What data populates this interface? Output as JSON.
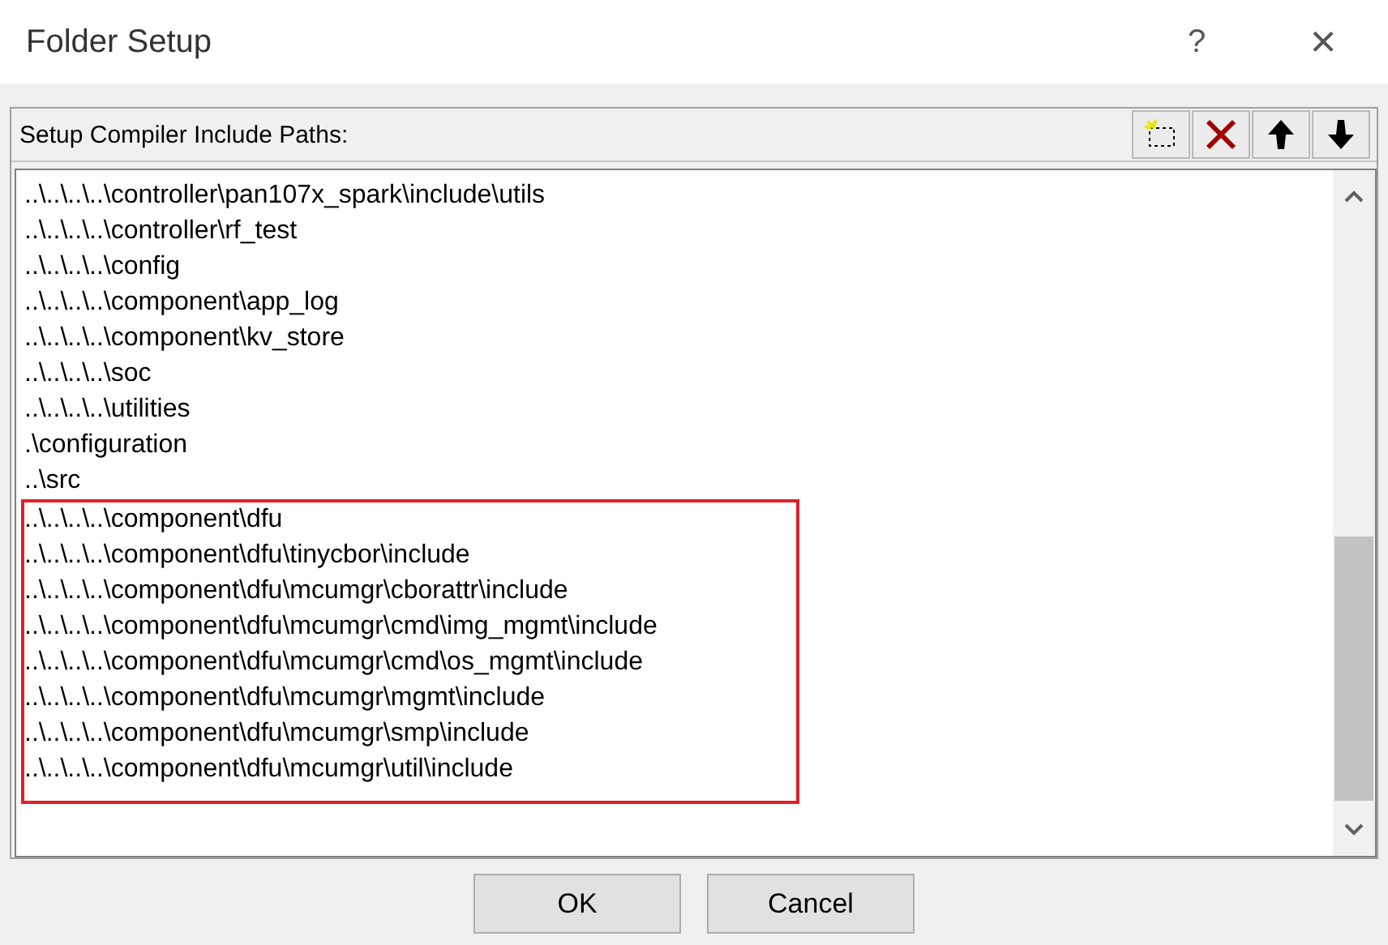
{
  "window": {
    "title": "Folder Setup",
    "help": "?",
    "close": "×"
  },
  "panel": {
    "title": "Setup Compiler Include Paths:"
  },
  "paths": [
    {
      "text": "..\\..\\..\\..\\controller\\pan107x_spark\\include\\utils",
      "highlighted": false
    },
    {
      "text": "..\\..\\..\\..\\controller\\rf_test",
      "highlighted": false
    },
    {
      "text": "..\\..\\..\\..\\config",
      "highlighted": false
    },
    {
      "text": "..\\..\\..\\..\\component\\app_log",
      "highlighted": false
    },
    {
      "text": "..\\..\\..\\..\\component\\kv_store",
      "highlighted": false
    },
    {
      "text": "..\\..\\..\\..\\soc",
      "highlighted": false
    },
    {
      "text": "..\\..\\..\\..\\utilities",
      "highlighted": false
    },
    {
      "text": ".\\configuration",
      "highlighted": false
    },
    {
      "text": "..\\src",
      "highlighted": false
    },
    {
      "text": "..\\..\\..\\..\\component\\dfu",
      "highlighted": true
    },
    {
      "text": "..\\..\\..\\..\\component\\dfu\\tinycbor\\include",
      "highlighted": true
    },
    {
      "text": "..\\..\\..\\..\\component\\dfu\\mcumgr\\cborattr\\include",
      "highlighted": true
    },
    {
      "text": "..\\..\\..\\..\\component\\dfu\\mcumgr\\cmd\\img_mgmt\\include",
      "highlighted": true
    },
    {
      "text": "..\\..\\..\\..\\component\\dfu\\mcumgr\\cmd\\os_mgmt\\include",
      "highlighted": true
    },
    {
      "text": "..\\..\\..\\..\\component\\dfu\\mcumgr\\mgmt\\include",
      "highlighted": true
    },
    {
      "text": "..\\..\\..\\..\\component\\dfu\\mcumgr\\smp\\include",
      "highlighted": true
    },
    {
      "text": "..\\..\\..\\..\\component\\dfu\\mcumgr\\util\\include",
      "highlighted": true
    }
  ],
  "buttons": [
    "OK",
    "Cancel"
  ]
}
